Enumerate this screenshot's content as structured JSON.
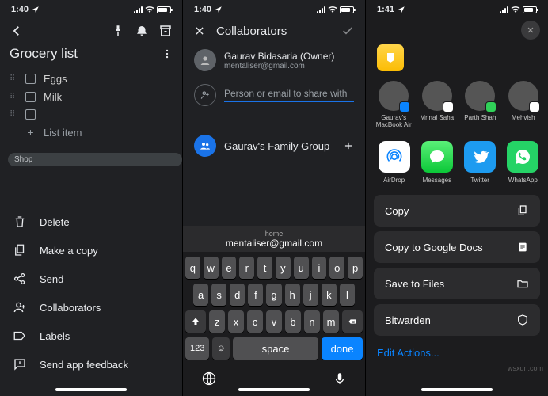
{
  "screen1": {
    "time": "1:40",
    "title": "Grocery list",
    "items": [
      "Eggs",
      "Milk"
    ],
    "add_item": "List item",
    "chip": "Shop",
    "menu": {
      "delete": "Delete",
      "copy": "Make a copy",
      "send": "Send",
      "collab": "Collaborators",
      "labels": "Labels",
      "feedback": "Send app feedback"
    }
  },
  "screen2": {
    "time": "1:40",
    "title": "Collaborators",
    "owner": {
      "name": "Gaurav Bidasaria (Owner)",
      "email": "mentaliser@gmail.com"
    },
    "input_placeholder": "Person or email to share with",
    "group": "Gaurav's Family Group",
    "suggest": {
      "label": "home",
      "value": "mentaliser@gmail.com"
    },
    "keys_r1": [
      "q",
      "w",
      "e",
      "r",
      "t",
      "y",
      "u",
      "i",
      "o",
      "p"
    ],
    "keys_r2": [
      "a",
      "s",
      "d",
      "f",
      "g",
      "h",
      "j",
      "k",
      "l"
    ],
    "keys_r3": [
      "z",
      "x",
      "c",
      "v",
      "b",
      "n",
      "m"
    ],
    "num_key": "123",
    "space_key": "space",
    "done_key": "done"
  },
  "screen3": {
    "time": "1:41",
    "contacts": [
      {
        "name": "Gaurav's MacBook Air",
        "badge": "#0a84ff"
      },
      {
        "name": "Mrinal Saha",
        "badge": "#fff"
      },
      {
        "name": "Parth Shah",
        "badge": "#30d158"
      },
      {
        "name": "Mehvish",
        "badge": "#fff"
      }
    ],
    "apps": {
      "airdrop": "AirDrop",
      "messages": "Messages",
      "twitter": "Twitter",
      "whatsapp": "WhatsApp"
    },
    "actions": {
      "copy": "Copy",
      "gdocs": "Copy to Google Docs",
      "files": "Save to Files",
      "bitwarden": "Bitwarden"
    },
    "edit": "Edit Actions..."
  },
  "watermark": "wsxdn.com"
}
